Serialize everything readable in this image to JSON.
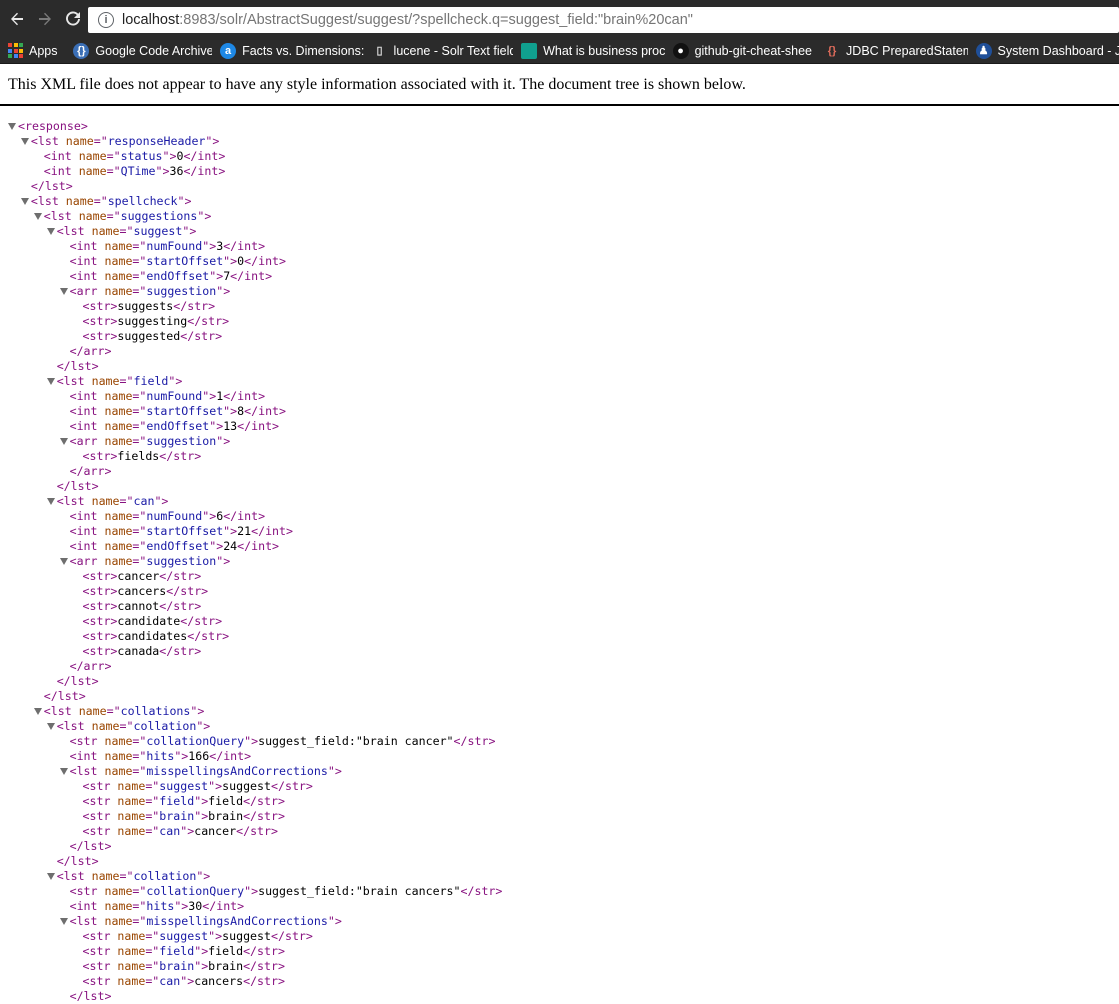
{
  "browser": {
    "url_host": "localhost",
    "url_rest": ":8983/solr/AbstractSuggest/suggest/?spellcheck.q=suggest_field:\"brain%20can\"",
    "bookmarks": [
      {
        "label": "Apps",
        "icon": "apps-grid-icon"
      },
      {
        "label": "Google Code Archive",
        "icon": "google-code-icon"
      },
      {
        "label": "Facts vs. Dimensions:",
        "icon": "blue-a-icon"
      },
      {
        "label": "lucene - Solr Text field",
        "icon": "page-icon"
      },
      {
        "label": "What is business proc",
        "icon": "teal-square-icon"
      },
      {
        "label": "github-git-cheat-shee",
        "icon": "github-icon"
      },
      {
        "label": "JDBC PreparedStatem",
        "icon": "bracket-icon"
      },
      {
        "label": "System Dashboard - J",
        "icon": "jira-icon"
      }
    ]
  },
  "viewer": {
    "notice": "This XML file does not appear to have any style information associated with it. The document tree is shown below."
  },
  "colors": {
    "tag": "#881280",
    "attr_name": "#994500",
    "attr_value": "#1a1aa6"
  },
  "xml_lines": [
    {
      "d": 0,
      "t": "open",
      "tag": "response",
      "tri": true
    },
    {
      "d": 1,
      "t": "open",
      "tag": "lst",
      "attr": "name",
      "val": "responseHeader",
      "tri": true
    },
    {
      "d": 2,
      "t": "el",
      "tag": "int",
      "attr": "name",
      "val": "status",
      "text": "0"
    },
    {
      "d": 2,
      "t": "el",
      "tag": "int",
      "attr": "name",
      "val": "QTime",
      "text": "36"
    },
    {
      "d": 1,
      "t": "close",
      "tag": "lst"
    },
    {
      "d": 1,
      "t": "open",
      "tag": "lst",
      "attr": "name",
      "val": "spellcheck",
      "tri": true
    },
    {
      "d": 2,
      "t": "open",
      "tag": "lst",
      "attr": "name",
      "val": "suggestions",
      "tri": true
    },
    {
      "d": 3,
      "t": "open",
      "tag": "lst",
      "attr": "name",
      "val": "suggest",
      "tri": true
    },
    {
      "d": 4,
      "t": "el",
      "tag": "int",
      "attr": "name",
      "val": "numFound",
      "text": "3"
    },
    {
      "d": 4,
      "t": "el",
      "tag": "int",
      "attr": "name",
      "val": "startOffset",
      "text": "0"
    },
    {
      "d": 4,
      "t": "el",
      "tag": "int",
      "attr": "name",
      "val": "endOffset",
      "text": "7"
    },
    {
      "d": 4,
      "t": "open",
      "tag": "arr",
      "attr": "name",
      "val": "suggestion",
      "tri": true
    },
    {
      "d": 5,
      "t": "el",
      "tag": "str",
      "text": "suggests"
    },
    {
      "d": 5,
      "t": "el",
      "tag": "str",
      "text": "suggesting"
    },
    {
      "d": 5,
      "t": "el",
      "tag": "str",
      "text": "suggested"
    },
    {
      "d": 4,
      "t": "close",
      "tag": "arr"
    },
    {
      "d": 3,
      "t": "close",
      "tag": "lst"
    },
    {
      "d": 3,
      "t": "open",
      "tag": "lst",
      "attr": "name",
      "val": "field",
      "tri": true
    },
    {
      "d": 4,
      "t": "el",
      "tag": "int",
      "attr": "name",
      "val": "numFound",
      "text": "1"
    },
    {
      "d": 4,
      "t": "el",
      "tag": "int",
      "attr": "name",
      "val": "startOffset",
      "text": "8"
    },
    {
      "d": 4,
      "t": "el",
      "tag": "int",
      "attr": "name",
      "val": "endOffset",
      "text": "13"
    },
    {
      "d": 4,
      "t": "open",
      "tag": "arr",
      "attr": "name",
      "val": "suggestion",
      "tri": true
    },
    {
      "d": 5,
      "t": "el",
      "tag": "str",
      "text": "fields"
    },
    {
      "d": 4,
      "t": "close",
      "tag": "arr"
    },
    {
      "d": 3,
      "t": "close",
      "tag": "lst"
    },
    {
      "d": 3,
      "t": "open",
      "tag": "lst",
      "attr": "name",
      "val": "can",
      "tri": true
    },
    {
      "d": 4,
      "t": "el",
      "tag": "int",
      "attr": "name",
      "val": "numFound",
      "text": "6"
    },
    {
      "d": 4,
      "t": "el",
      "tag": "int",
      "attr": "name",
      "val": "startOffset",
      "text": "21"
    },
    {
      "d": 4,
      "t": "el",
      "tag": "int",
      "attr": "name",
      "val": "endOffset",
      "text": "24"
    },
    {
      "d": 4,
      "t": "open",
      "tag": "arr",
      "attr": "name",
      "val": "suggestion",
      "tri": true
    },
    {
      "d": 5,
      "t": "el",
      "tag": "str",
      "text": "cancer"
    },
    {
      "d": 5,
      "t": "el",
      "tag": "str",
      "text": "cancers"
    },
    {
      "d": 5,
      "t": "el",
      "tag": "str",
      "text": "cannot"
    },
    {
      "d": 5,
      "t": "el",
      "tag": "str",
      "text": "candidate"
    },
    {
      "d": 5,
      "t": "el",
      "tag": "str",
      "text": "candidates"
    },
    {
      "d": 5,
      "t": "el",
      "tag": "str",
      "text": "canada"
    },
    {
      "d": 4,
      "t": "close",
      "tag": "arr"
    },
    {
      "d": 3,
      "t": "close",
      "tag": "lst"
    },
    {
      "d": 2,
      "t": "close",
      "tag": "lst"
    },
    {
      "d": 2,
      "t": "open",
      "tag": "lst",
      "attr": "name",
      "val": "collations",
      "tri": true
    },
    {
      "d": 3,
      "t": "open",
      "tag": "lst",
      "attr": "name",
      "val": "collation",
      "tri": true
    },
    {
      "d": 4,
      "t": "el",
      "tag": "str",
      "attr": "name",
      "val": "collationQuery",
      "text": "suggest_field:\"brain cancer\""
    },
    {
      "d": 4,
      "t": "el",
      "tag": "int",
      "attr": "name",
      "val": "hits",
      "text": "166"
    },
    {
      "d": 4,
      "t": "open",
      "tag": "lst",
      "attr": "name",
      "val": "misspellingsAndCorrections",
      "tri": true
    },
    {
      "d": 5,
      "t": "el",
      "tag": "str",
      "attr": "name",
      "val": "suggest",
      "text": "suggest"
    },
    {
      "d": 5,
      "t": "el",
      "tag": "str",
      "attr": "name",
      "val": "field",
      "text": "field"
    },
    {
      "d": 5,
      "t": "el",
      "tag": "str",
      "attr": "name",
      "val": "brain",
      "text": "brain"
    },
    {
      "d": 5,
      "t": "el",
      "tag": "str",
      "attr": "name",
      "val": "can",
      "text": "cancer"
    },
    {
      "d": 4,
      "t": "close",
      "tag": "lst"
    },
    {
      "d": 3,
      "t": "close",
      "tag": "lst"
    },
    {
      "d": 3,
      "t": "open",
      "tag": "lst",
      "attr": "name",
      "val": "collation",
      "tri": true
    },
    {
      "d": 4,
      "t": "el",
      "tag": "str",
      "attr": "name",
      "val": "collationQuery",
      "text": "suggest_field:\"brain cancers\""
    },
    {
      "d": 4,
      "t": "el",
      "tag": "int",
      "attr": "name",
      "val": "hits",
      "text": "30"
    },
    {
      "d": 4,
      "t": "open",
      "tag": "lst",
      "attr": "name",
      "val": "misspellingsAndCorrections",
      "tri": true
    },
    {
      "d": 5,
      "t": "el",
      "tag": "str",
      "attr": "name",
      "val": "suggest",
      "text": "suggest"
    },
    {
      "d": 5,
      "t": "el",
      "tag": "str",
      "attr": "name",
      "val": "field",
      "text": "field"
    },
    {
      "d": 5,
      "t": "el",
      "tag": "str",
      "attr": "name",
      "val": "brain",
      "text": "brain"
    },
    {
      "d": 5,
      "t": "el",
      "tag": "str",
      "attr": "name",
      "val": "can",
      "text": "cancers"
    },
    {
      "d": 4,
      "t": "close",
      "tag": "lst"
    }
  ]
}
